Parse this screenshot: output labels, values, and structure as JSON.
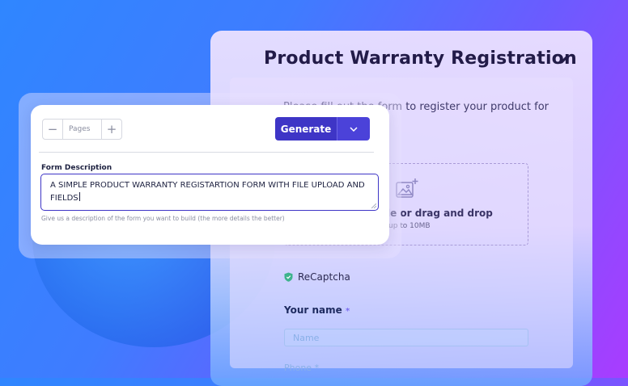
{
  "back_form": {
    "title": "Product Warranty Registration",
    "intro": "Please fill out the form to register your product for",
    "upload": {
      "text": "le or drag and drop",
      "subtext": "up to 10MB"
    },
    "recaptcha_label": "ReCaptcha",
    "name_label": "Your name",
    "required_mark": "*",
    "name_placeholder": "Name",
    "phone_label": "Phone *"
  },
  "generator": {
    "pages_placeholder": "Pages",
    "minus_label": "−",
    "plus_label": "+",
    "generate_label": "Generate",
    "description_label": "Form Description",
    "description_value": "A SIMPLE PRODUCT WARRANTY REGISTARTION FORM WITH FILE UPLOAD AND FIELDS",
    "help_text": "Give us a description of the form you want to build (the more details the better)"
  },
  "colors": {
    "accent": "#3e35c6",
    "title": "#221b48",
    "recaptcha": "#3db38c"
  },
  "icons": [
    "edit-icon",
    "image-upload-icon",
    "shield-check-icon",
    "chevron-down-icon",
    "resize-grip-icon"
  ]
}
